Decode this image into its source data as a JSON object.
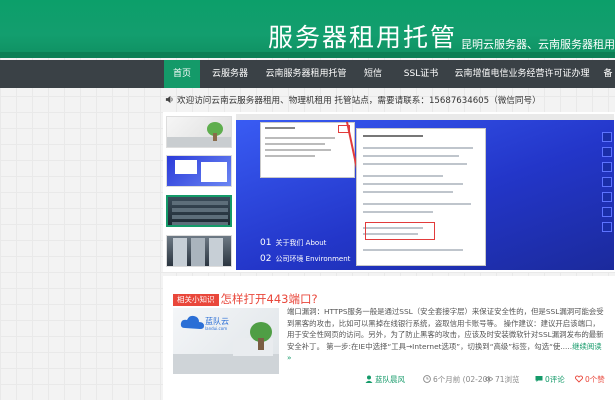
{
  "header": {
    "site_title": "服务器租用托管",
    "site_sub": "昆明云服务器、云南服务器租用"
  },
  "nav": {
    "items": [
      {
        "label": "首页",
        "active": true
      },
      {
        "label": "云服务器"
      },
      {
        "label": "云南服务器租用托管"
      },
      {
        "label": "短信"
      },
      {
        "label": "SSL证书"
      },
      {
        "label": "云南增值电信业务经营许可证办理"
      },
      {
        "label": "备"
      }
    ]
  },
  "notice": {
    "text": "欢迎访问云南云服务器租用、物理机租用 托管站点，需要请联系：15687634605（微信同号）"
  },
  "gallery": {
    "labels": [
      {
        "num": "01",
        "text": "关于我们 About"
      },
      {
        "num": "02",
        "text": "公司环境 Environment"
      }
    ]
  },
  "article": {
    "tag": "相关小知识",
    "title": "怎样打开443端口?",
    "logo_text": "蓝队云",
    "logo_sub": "landui.com",
    "excerpt": "端口漏洞：HTTPS服务一般是通过SSL（安全套接字层）来保证安全性的，但是SSL漏洞可能会受到黑客的攻击，比如可以黑掉在线银行系统，盗取信用卡账号等。 操作建议：建议开启该端口，用于安全性网页的访问。另外，为了防止黑客的攻击，应该及时安装微软针对SSL漏洞发布的最新安全补丁。 第一步:在IE中选择“工具→Internet选项”，切换到“高级”标签，勾选“使.....",
    "more_label": "继续阅读 »",
    "author": "蓝队晨风",
    "time": "6个月前 (02-20)",
    "views": "71浏览",
    "comments": "0评论",
    "likes": "0个赞"
  },
  "colors": {
    "brand_green": "#149a69",
    "nav_bg": "#3a4146",
    "accent_red": "#e9473b"
  }
}
